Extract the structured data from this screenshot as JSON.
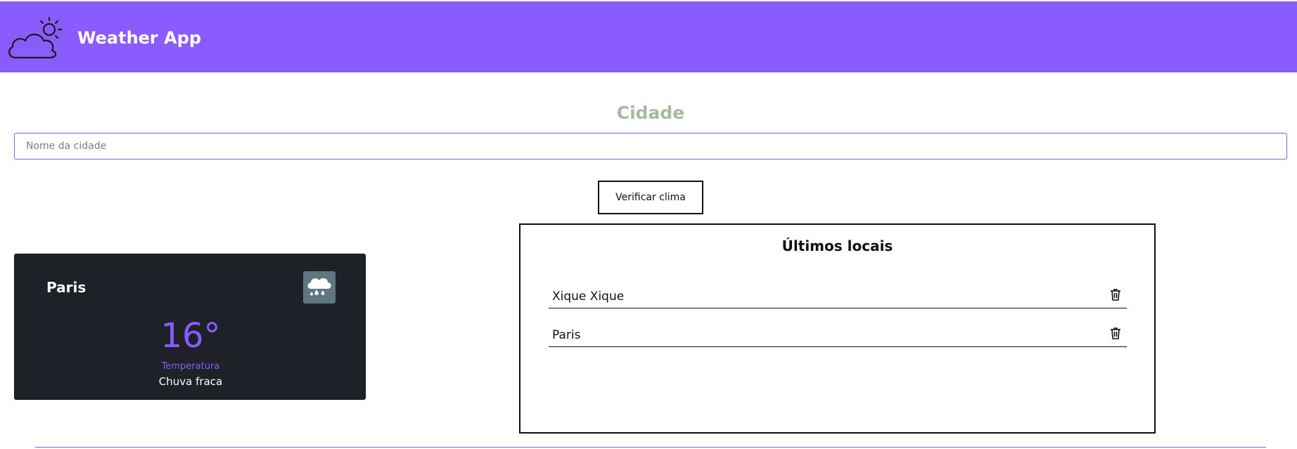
{
  "header": {
    "title": "Weather App",
    "logo_icon": "cloud-sun-icon"
  },
  "search": {
    "heading": "Cidade",
    "placeholder": "Nome da cidade",
    "value": "",
    "button_label": "Verificar clima"
  },
  "weather_card": {
    "city": "Paris",
    "temperature": "16°",
    "temperature_label": "Temperatura",
    "condition": "Chuva fraca",
    "icon": "rain-cloud-icon"
  },
  "recent": {
    "title": "Últimos locais",
    "items": [
      {
        "name": "Xique Xique"
      },
      {
        "name": "Paris"
      }
    ],
    "delete_icon": "trash-icon"
  },
  "colors": {
    "accent": "#8a5cff",
    "card_bg": "#1e2127",
    "heading_muted": "#a7b8a3",
    "icon_box": "#5f7783"
  }
}
